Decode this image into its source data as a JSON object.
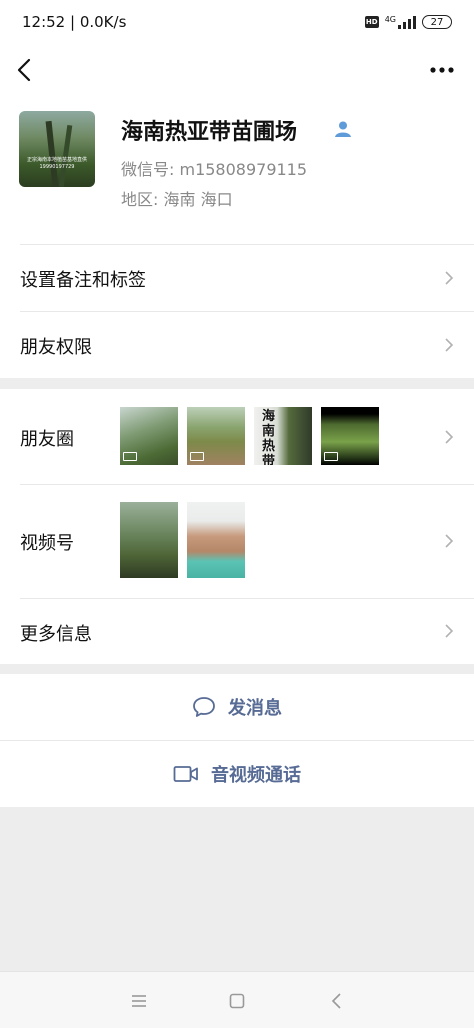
{
  "status_bar": {
    "time": "12:52 | 0.0K/s",
    "hd": "HD",
    "network": "4G",
    "battery": "27"
  },
  "profile": {
    "name": "海南热亚带苗圃场",
    "wechat_id": "微信号:  m15808979115",
    "region": "地区:  海南  海口",
    "avatar_caption": "正宗海南本地植苗基地直供 19990197729"
  },
  "rows": {
    "remark_tags": "设置备注和标签",
    "friend_permissions": "朋友权限",
    "moments": "朋友圈",
    "channels": "视频号",
    "more_info": "更多信息"
  },
  "moments_thumb3_text": "海南热带",
  "actions": {
    "send_message": "发消息",
    "av_call": "音视频通话"
  },
  "colors": {
    "link": "#576b95",
    "background": "#ededed",
    "person_badge": "#5f9bd8"
  }
}
